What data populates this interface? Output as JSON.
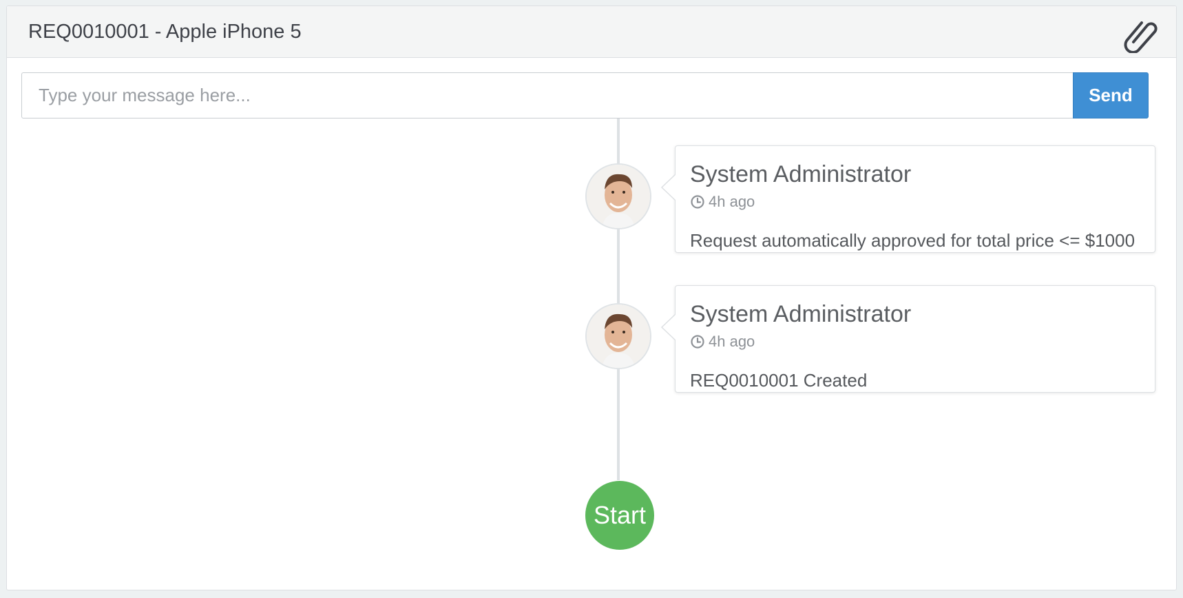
{
  "header": {
    "title": "REQ0010001 - Apple iPhone 5",
    "attach_icon": "paperclip-icon"
  },
  "composer": {
    "placeholder": "Type your message here...",
    "value": "",
    "send_label": "Send",
    "send_color": "#3f8fd4"
  },
  "timeline": {
    "entries": [
      {
        "author": "System Administrator",
        "time": "4h ago",
        "body": "Request automatically approved for total price <= $1000",
        "avatar_icon": "user-avatar"
      },
      {
        "author": "System Administrator",
        "time": "4h ago",
        "body": "REQ0010001 Created",
        "avatar_icon": "user-avatar"
      }
    ],
    "start_label": "Start",
    "start_color": "#5cb85c"
  }
}
